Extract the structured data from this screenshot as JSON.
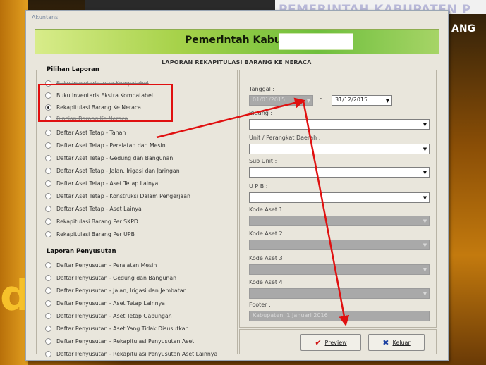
{
  "background": {
    "title_line1": "PEMERINTAH KABUPATEN P",
    "title_line2": "ANG",
    "big_letter": "d"
  },
  "window": {
    "title": "Akuntansi",
    "banner_title": "Pemerintah Kabupaten",
    "report_heading": "LAPORAN REKAPITULASI BARANG KE NERACA"
  },
  "pilihan_laporan": {
    "legend": "Pilihan Laporan",
    "options": [
      {
        "label": "Buku Inventaris Intra Kompatabel",
        "selected": false,
        "struck": true
      },
      {
        "label": "Buku Inventaris Ekstra Kompatabel",
        "selected": false,
        "struck": false
      },
      {
        "label": "Rekapitulasi Barang Ke Neraca",
        "selected": true,
        "struck": false
      },
      {
        "label": "Rincian Barang Ke Neraca",
        "selected": false,
        "struck": true
      },
      {
        "label": "Daftar Aset Tetap - Tanah",
        "selected": false,
        "struck": false
      },
      {
        "label": "Daftar Aset Tetap - Peralatan dan Mesin",
        "selected": false,
        "struck": false
      },
      {
        "label": "Daftar Aset Tetap - Gedung dan Bangunan",
        "selected": false,
        "struck": false
      },
      {
        "label": "Daftar Aset Tetap - Jalan, Irigasi dan Jaringan",
        "selected": false,
        "struck": false
      },
      {
        "label": "Daftar Aset Tetap - Aset Tetap Lainya",
        "selected": false,
        "struck": false
      },
      {
        "label": "Daftar Aset Tetap - Konstruksi Dalam Pengerjaan",
        "selected": false,
        "struck": false
      },
      {
        "label": "Daftar Aset Tetap - Aset Lainya",
        "selected": false,
        "struck": false
      },
      {
        "label": "Rekapitulasi Barang Per SKPD",
        "selected": false,
        "struck": false
      },
      {
        "label": "Rekapitulasi Barang Per UPB",
        "selected": false,
        "struck": false
      }
    ]
  },
  "laporan_penyusutan": {
    "legend": "Laporan Penyusutan",
    "options": [
      {
        "label": "Daftar Penyusutan - Peralatan Mesin",
        "selected": false
      },
      {
        "label": "Daftar Penyusutan - Gedung dan Bangunan",
        "selected": false
      },
      {
        "label": "Daftar Penyusutan - Jalan, Irigasi dan Jembatan",
        "selected": false
      },
      {
        "label": "Daftar Penyusutan - Aset Tetap Lainnya",
        "selected": false
      },
      {
        "label": "Daftar Penyusutan - Aset Tetap Gabungan",
        "selected": false
      },
      {
        "label": "Daftar Penyusutan - Aset Yang Tidak Disusutkan",
        "selected": false
      },
      {
        "label": "Daftar Penyusutan - Rekapitulasi Penyusutan Aset",
        "selected": false
      },
      {
        "label": "Daftar Penyusutan - Rekapitulasi Penyusutan Aset Lainnya",
        "selected": false
      }
    ]
  },
  "form": {
    "tanggal_label": "Tanggal :",
    "date_from": "01/01/2015",
    "date_separator": "-",
    "date_to": "31/12/2015",
    "bidang_label": "Bidang :",
    "unit_label": "Unit / Perangkat Daerah :",
    "subunit_label": "Sub Unit :",
    "upb_label": "U P B :",
    "kode1_label": "Kode Aset 1",
    "kode2_label": "Kode Aset 2",
    "kode3_label": "Kode Aset 3",
    "kode4_label": "Kode Aset 4",
    "footer_label": "Footer :",
    "footer_value": "Kabupaten, 1 Januari 2016"
  },
  "buttons": {
    "preview_label": "Preview",
    "keluar_label": "Keluar"
  },
  "colors": {
    "annotation": "#e01010",
    "banner_green": "#6fbf3d"
  }
}
